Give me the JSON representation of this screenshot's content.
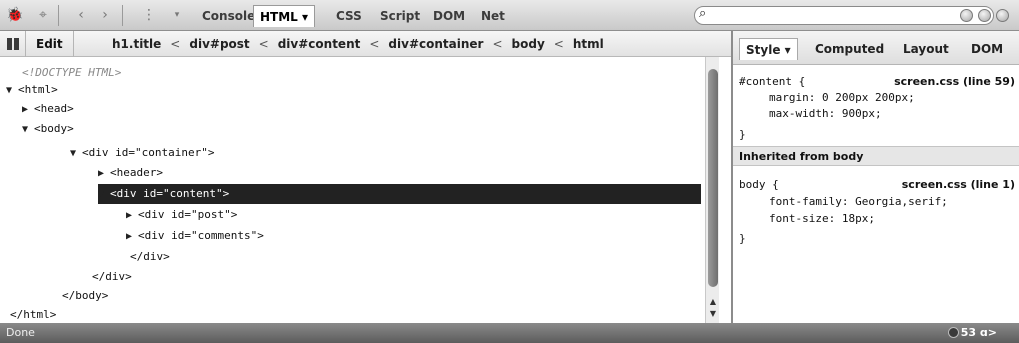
{
  "toolbar": {
    "tabs": [
      {
        "label": "Console"
      },
      {
        "label": "HTML ▾"
      },
      {
        "label": "CSS"
      },
      {
        "label": "Script"
      },
      {
        "label": "DOM"
      },
      {
        "label": "Net"
      }
    ],
    "search": {
      "value": "",
      "placeholder": ""
    },
    "icons": [
      "bug-icon",
      "inspect-icon",
      "back-icon",
      "forward-icon",
      "dropdown-icon",
      "search-icon"
    ]
  },
  "crumbbar": {
    "edit_label": "Edit",
    "breadcrumbs": [
      "h1.title",
      "div#post",
      "div#content",
      "div#container",
      "body",
      "html"
    ],
    "separator": "<"
  },
  "html_tree": [
    {
      "twisty": "",
      "text": "<!DOCTYPE HTML>"
    },
    {
      "twisty": "▼",
      "text": "<html>"
    },
    {
      "twisty": "▶",
      "text": "<head>"
    },
    {
      "twisty": "▼",
      "text": "<body>"
    },
    {
      "twisty": "▼",
      "text": "<div id=\"container\">"
    },
    {
      "twisty": "▶",
      "text": "<header>"
    },
    {
      "twisty": "▼",
      "text": "<div id=\"content\">"
    },
    {
      "twisty": "▶",
      "text": "<div id=\"post\">"
    },
    {
      "twisty": "▶",
      "text": "<div id=\"comments\">"
    },
    {
      "twisty": "",
      "text": "</div>"
    },
    {
      "twisty": "",
      "text": "</div>"
    },
    {
      "twisty": "",
      "text": "</body>"
    },
    {
      "twisty": "",
      "text": "</html>"
    }
  ],
  "side_panel": {
    "tabs": [
      {
        "label": "Style ▾"
      },
      {
        "label": "Computed"
      },
      {
        "label": "Layout"
      },
      {
        "label": "DOM"
      }
    ],
    "rule1": {
      "selector": "#content {",
      "source": "screen.css (line 59)",
      "props": [
        "margin: 0 200px 200px;",
        "max-width: 900px;"
      ],
      "close": "}"
    },
    "inherited_label": "Inherited from body",
    "rule2": {
      "selector": "body {",
      "source": "screen.css (line 1)",
      "props": [
        "font-family: Georgia,serif;",
        "font-size: 18px;"
      ],
      "close": "}"
    }
  },
  "status": {
    "text": "Done",
    "count": "53 ɑ>"
  },
  "colors": {
    "selection": "#222222",
    "toolbar": "#d6d6d6",
    "statusbar": "#707070"
  }
}
